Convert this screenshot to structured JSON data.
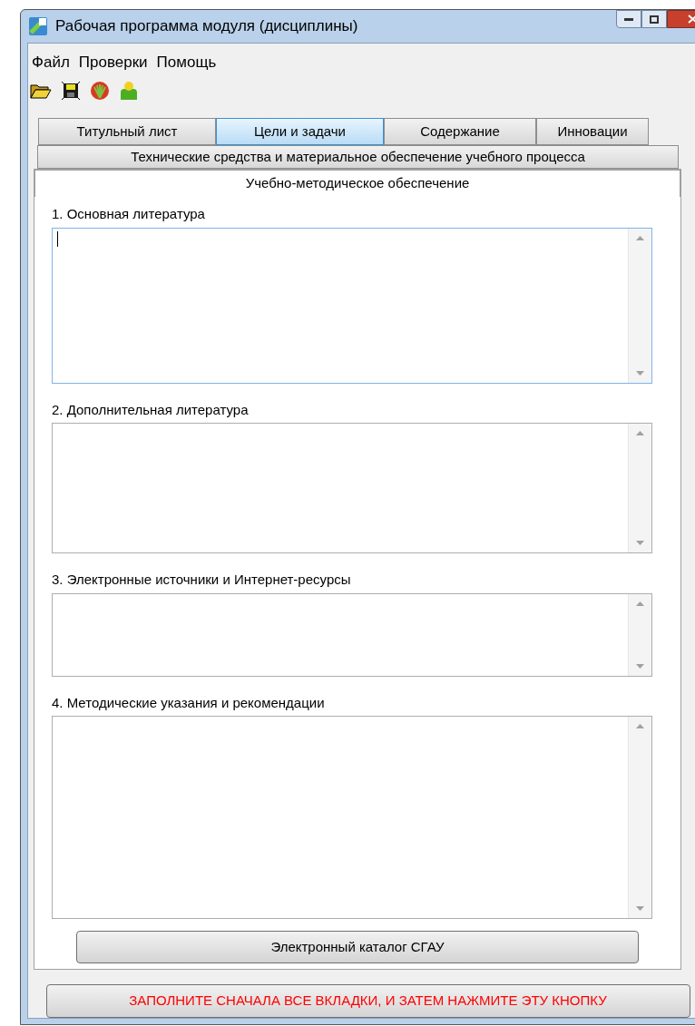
{
  "window": {
    "title": "Рабочая программа модуля (дисциплины)"
  },
  "menu": [
    "Файл",
    "Проверки",
    "Помощь"
  ],
  "toolbar": [
    {
      "kind": "open"
    },
    {
      "kind": "save"
    },
    {
      "kind": "shell"
    },
    {
      "kind": "user"
    }
  ],
  "tab_rows": [
    [
      {
        "label": "Титульный лист",
        "selected": false,
        "highlighted": false
      },
      {
        "label": "Цели и задачи",
        "selected": false,
        "highlighted": true
      },
      {
        "label": "Содержание",
        "selected": false,
        "highlighted": false
      },
      {
        "label": "Инновации",
        "selected": false,
        "highlighted": false
      }
    ],
    [
      {
        "label": "Технические средства и материальное обеспечение учебного процесса",
        "selected": false,
        "highlighted": false
      }
    ],
    [
      {
        "label": "Учебно-методическое обеспечение",
        "selected": true,
        "highlighted": false
      }
    ]
  ],
  "sections": [
    {
      "label": "1. Основная литература",
      "focused": true
    },
    {
      "label": "2. Дополнительная литература",
      "focused": false
    },
    {
      "label": "3. Электронные источники и Интернет-ресурсы",
      "focused": false
    },
    {
      "label": "4. Методические указания и рекомендации",
      "focused": false
    }
  ],
  "catalog_button": "Электронный каталог СГАУ",
  "submit_button": "ЗАПОЛНИТЕ СНАЧАЛА ВСЕ ВКЛАДКИ, И ЗАТЕМ НАЖМИТЕ ЭТУ КНОПКУ"
}
